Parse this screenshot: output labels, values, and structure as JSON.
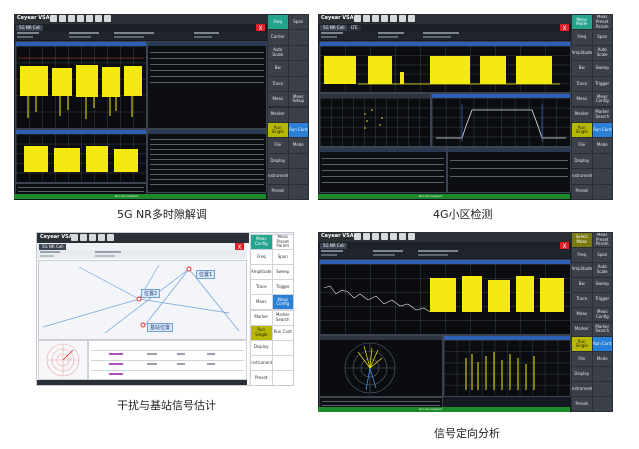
{
  "app": {
    "title": "Ceyear VSA",
    "tab": "5G NR Cell",
    "tab_4g": "5G NR Cell",
    "tab_4g_sub": "LTE",
    "close": "X"
  },
  "panels": [
    {
      "caption": "5G NR多时隙解调",
      "softkeys": [
        "Freq",
        "Span",
        "Carrier",
        "",
        "Auto Scale",
        "",
        "Bw",
        "",
        "Trace",
        "",
        "Meas",
        "Meas Setup",
        "Marker",
        "",
        "Run Single",
        "Run Cont",
        "File",
        "Mode",
        "Display",
        "",
        "Instrument",
        "",
        "Preset",
        ""
      ]
    },
    {
      "caption": "4G小区检测",
      "softkeys": [
        "Meas Mode",
        "Meas Preset Param",
        "Freq",
        "Span",
        "Amplitude",
        "Auto Scale",
        "Bw",
        "Sweep",
        "Trace",
        "Trigger",
        "Meas",
        "Meas Config",
        "Marker",
        "Marker Search",
        "Run Single",
        "Run Cont",
        "File",
        "Mode",
        "Display",
        "",
        "Instrument",
        "",
        "Preset",
        ""
      ]
    },
    {
      "caption": "干扰与基站信号估计",
      "softkeys": [
        "Meas Config",
        "Meas Preset Param",
        "Freq",
        "Span",
        "Amplitude",
        "Sweep",
        "Trace",
        "Trigger",
        "Meas",
        "Meas Config",
        "Marker",
        "Marker Search",
        "Run Single",
        "Run Cont",
        "Display",
        "",
        "Instrument",
        "",
        "Preset",
        ""
      ],
      "map_labels": {
        "pos1": "位置1",
        "pos2": "位置2",
        "pos3": "位置3",
        "station": "基站位置"
      }
    },
    {
      "caption": "信号定向分析",
      "softkeys": [
        "Select Meas",
        "Meas Preset Param",
        "Freq",
        "Span",
        "Amplitude",
        "Auto Scale",
        "Bw",
        "Sweep",
        "Trace",
        "Trigger",
        "Meas",
        "Meas Config",
        "Marker",
        "Marker Search",
        "Run Single",
        "Run Cont",
        "File",
        "Mode",
        "Display",
        "",
        "Instrument",
        "",
        "Preset",
        ""
      ]
    }
  ],
  "status_text": "Run Succeeded",
  "colors": {
    "trace": "#f4ea12",
    "accent_green": "#24a48c",
    "close_red": "#e21f26"
  }
}
